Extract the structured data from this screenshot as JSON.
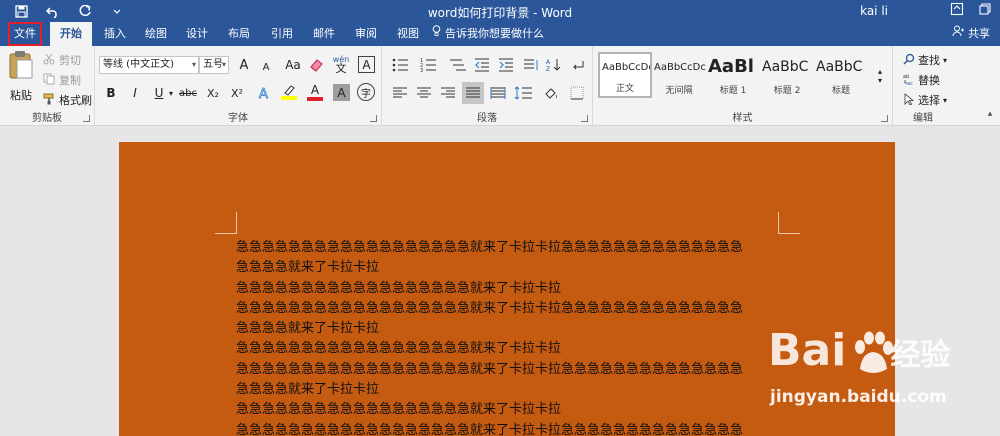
{
  "titlebar": {
    "doc_title": "word如何打印背景 - Word",
    "user": "kai li",
    "qat_icons": [
      "save-icon",
      "undo-icon",
      "redo-icon",
      "customize-icon"
    ],
    "window_buttons": [
      "ribbon-display-icon",
      "restore-icon"
    ]
  },
  "tabs": {
    "file": "文件",
    "home": "开始",
    "insert": "插入",
    "draw": "绘图",
    "design": "设计",
    "layout": "布局",
    "references": "引用",
    "mailings": "邮件",
    "review": "审阅",
    "view": "视图",
    "tell_me": "告诉我你想要做什么",
    "share": "共享"
  },
  "clipboard": {
    "paste": "粘贴",
    "cut": "剪切",
    "copy": "复制",
    "format_painter": "格式刷",
    "label": "剪贴板"
  },
  "font": {
    "font_name": "等线 (中文正文)",
    "font_size": "五号",
    "change_case": "Aa",
    "phonetic": "wén",
    "bold": "B",
    "italic": "I",
    "underline": "U",
    "strikethrough": "abc",
    "subscript": "X₂",
    "superscript": "X²",
    "enclose": "字",
    "label": "字体",
    "char_border": "A",
    "grow": "A",
    "shrink": "A"
  },
  "paragraph": {
    "label": "段落"
  },
  "styles": {
    "items": [
      {
        "sample": "AaBbCcDc",
        "name": "正文"
      },
      {
        "sample": "AaBbCcDc",
        "name": "无间隔"
      },
      {
        "sample": "AaBl",
        "name": "标题 1"
      },
      {
        "sample": "AaBbC",
        "name": "标题 2"
      },
      {
        "sample": "AaBbC",
        "name": "标题"
      }
    ],
    "label": "样式"
  },
  "editing": {
    "find": "查找",
    "replace": "替换",
    "select": "选择",
    "label": "编辑"
  },
  "colors": {
    "ribbon_blue": "#2b579a",
    "page_background": "#c55a11",
    "highlight": "#ffff00",
    "font_color": "#e0202a"
  },
  "document": {
    "lines": [
      "急急急急急急急急急急急急急急急急急急就来了卡拉卡拉急急急急急急急急急急急急急急",
      "急急急急就来了卡拉卡拉",
      "急急急急急急急急急急急急急急急急急急就来了卡拉卡拉",
      "急急急急急急急急急急急急急急急急急急就来了卡拉卡拉急急急急急急急急急急急急急急",
      "急急急急就来了卡拉卡拉",
      "急急急急急急急急急急急急急急急急急急就来了卡拉卡拉",
      "急急急急急急急急急急急急急急急急急急就来了卡拉卡拉急急急急急急急急急急急急急急",
      "急急急急就来了卡拉卡拉",
      "急急急急急急急急急急急急急急急急急急就来了卡拉卡拉",
      "急急急急急急急急急急急急急急急急急急就来了卡拉卡拉急急急急急急急急急急急急急急"
    ]
  },
  "watermark": {
    "brand": "Bai",
    "brand_suffix": "经验",
    "url": "jingyan.baidu.com"
  }
}
